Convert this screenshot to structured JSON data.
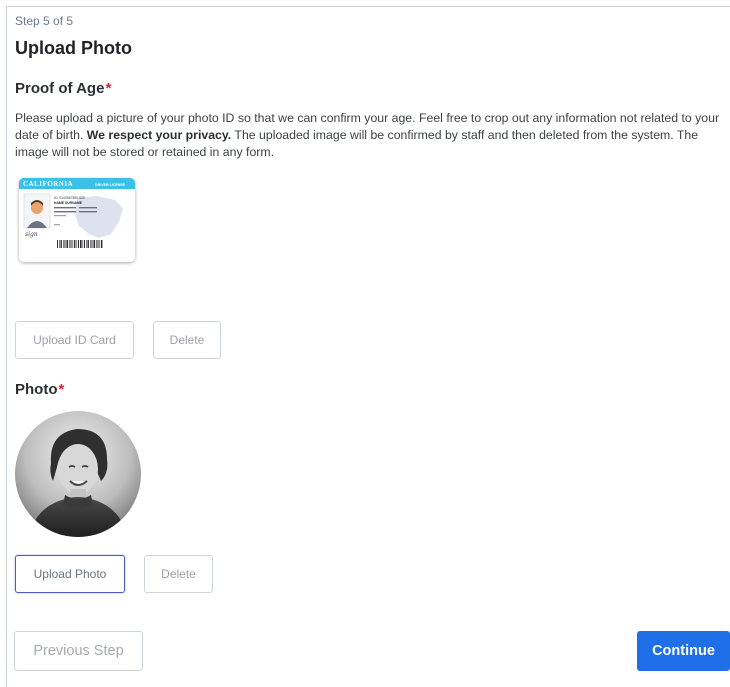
{
  "header": {
    "step": "Step 5 of 5",
    "title": "Upload Photo"
  },
  "proof_of_age": {
    "label": "Proof of Age",
    "required_marker": "*",
    "description_part1": "Please upload a picture of your photo ID so that we can confirm your age. Feel free to crop out any information not related to your date of birth. ",
    "description_bold": "We respect your privacy.",
    "description_part2": " The uploaded image will be confirmed by staff and then deleted from the system. The image will not be stored or retained in any form.",
    "upload_button": "Upload ID Card",
    "delete_button": "Delete",
    "card": {
      "state": "CALIFORNIA",
      "type": "DRIVER LICENSE",
      "id_line": "ID: 0143567890 835",
      "name": "NAME SURNAME",
      "signature": "sign"
    }
  },
  "photo": {
    "label": "Photo",
    "required_marker": "*",
    "upload_button": "Upload Photo",
    "delete_button": "Delete"
  },
  "footer": {
    "previous_button": "Previous Step",
    "continue_button": "Continue"
  },
  "colors": {
    "primary": "#1e6fe8",
    "required": "#d0283a",
    "step_text": "#6c7a91"
  }
}
